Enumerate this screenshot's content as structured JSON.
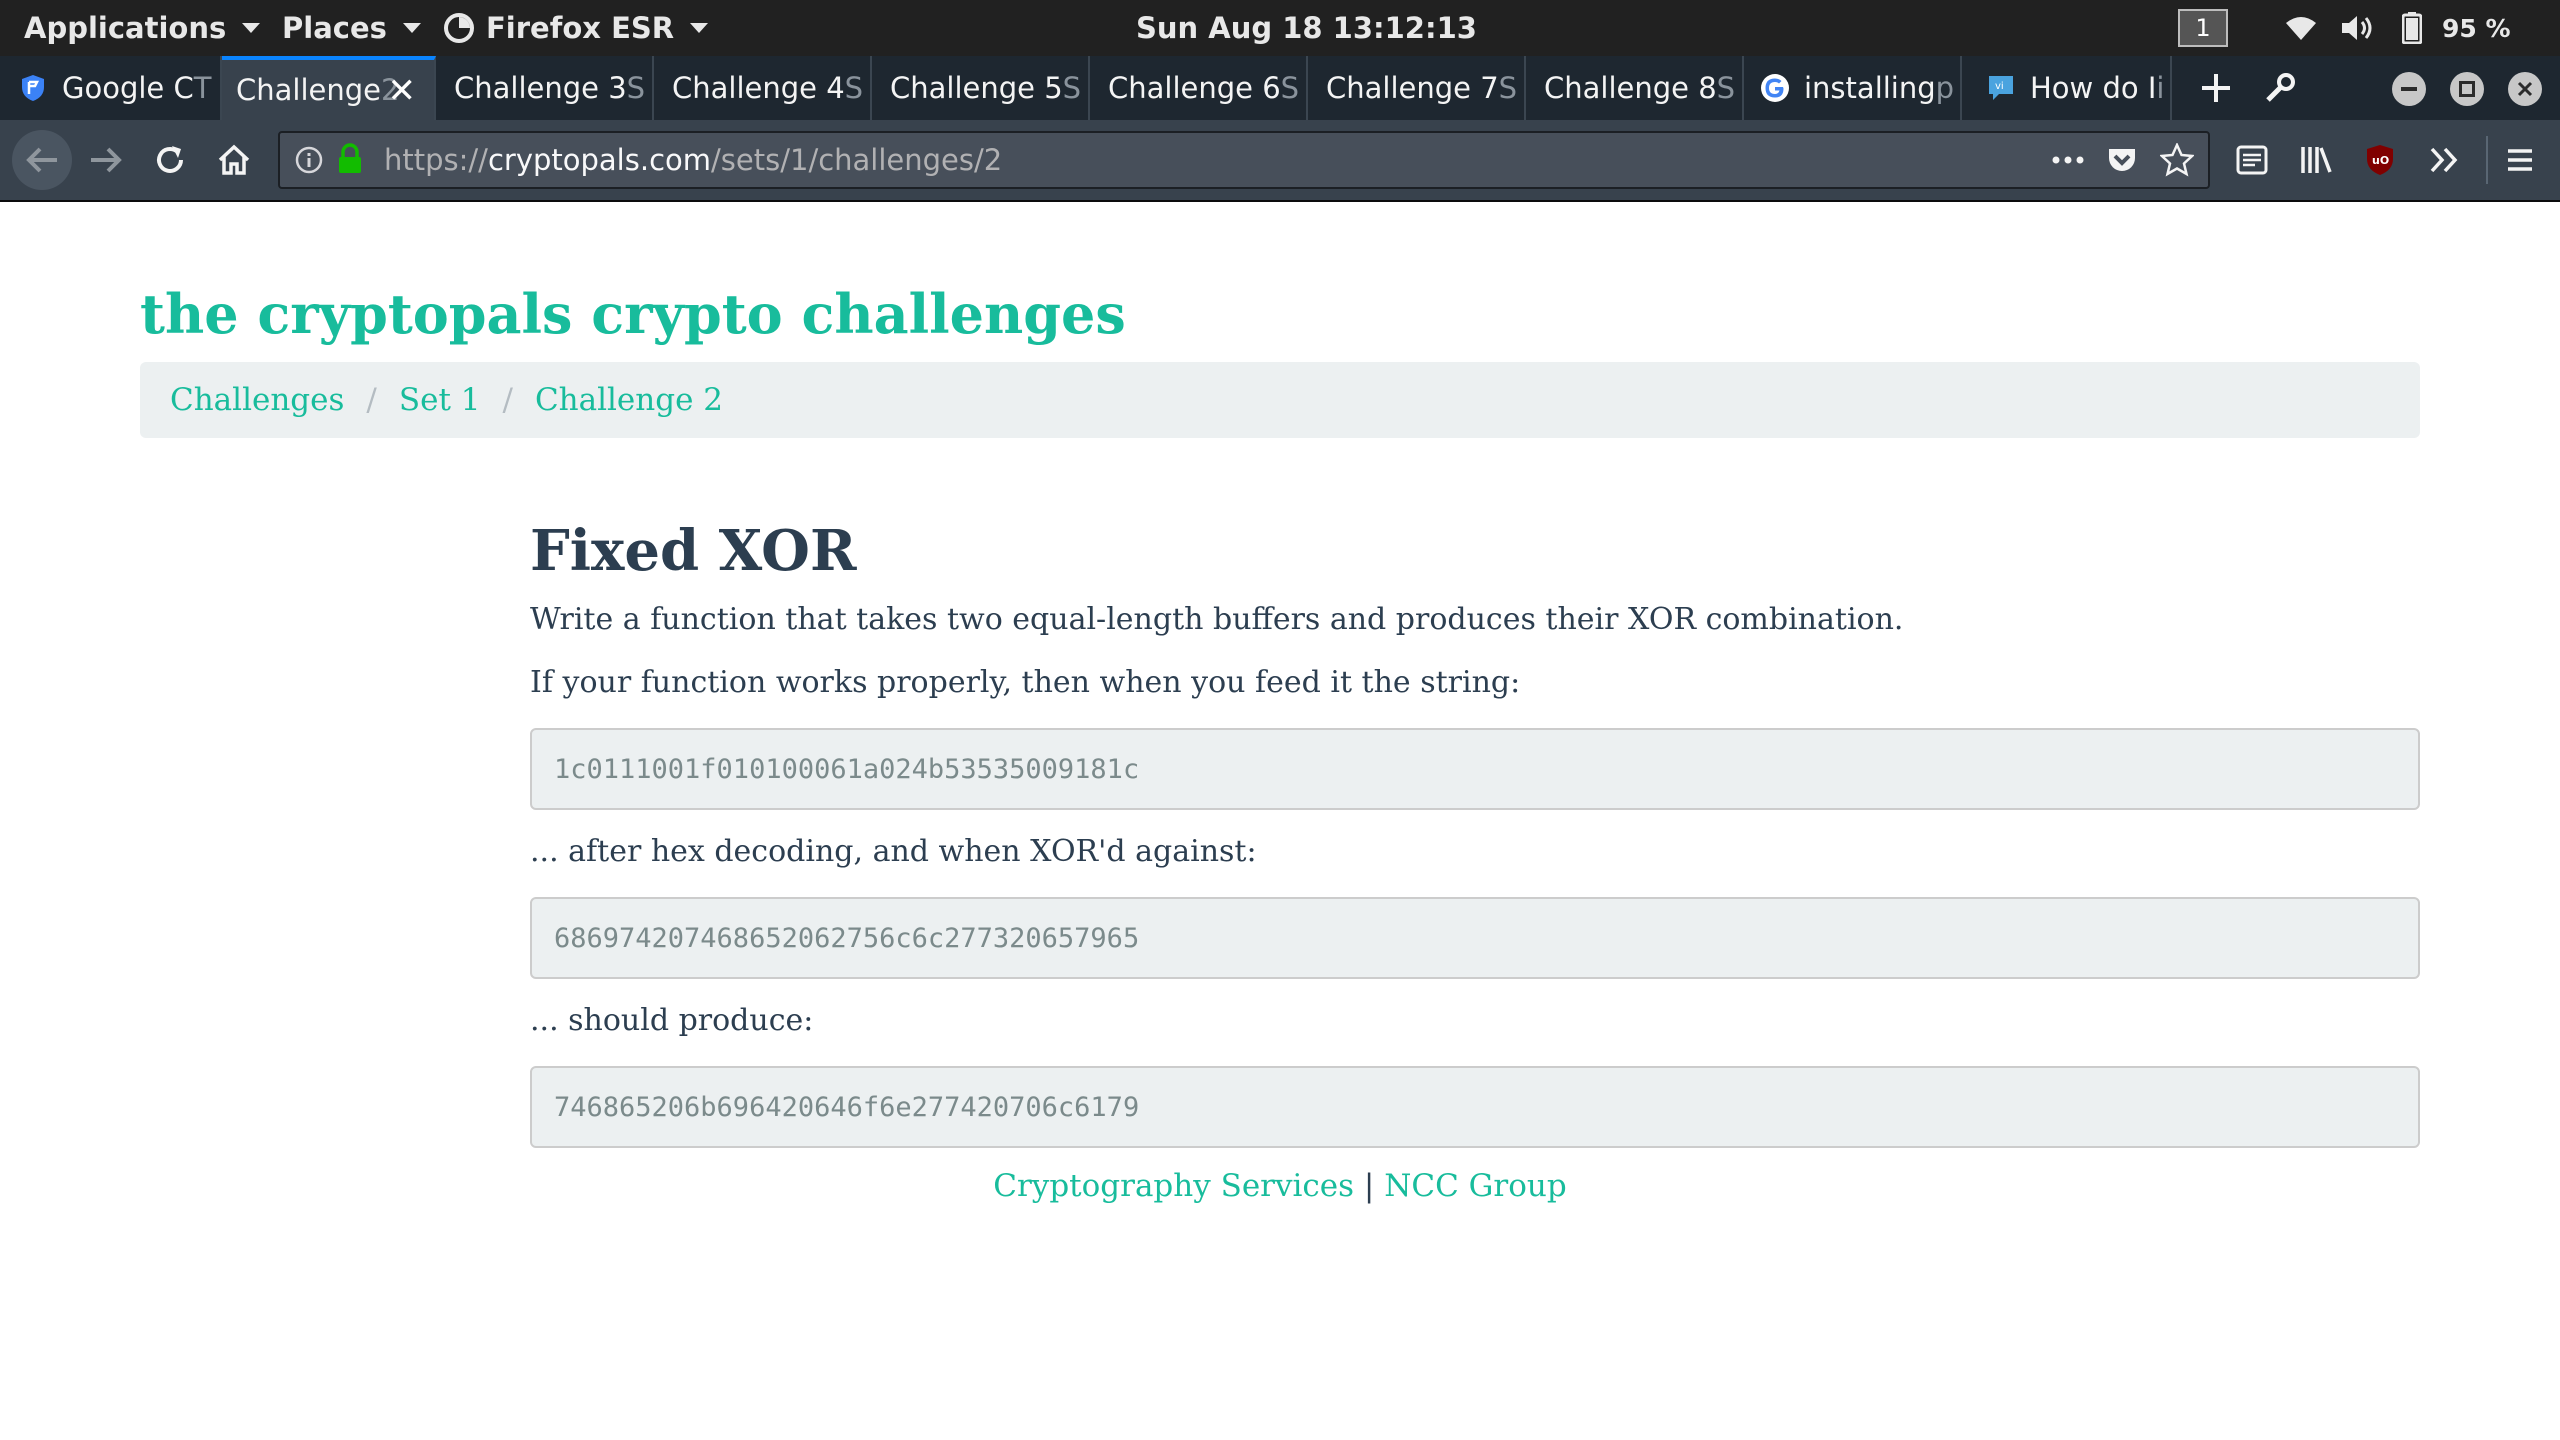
{
  "topbar": {
    "applications": "Applications",
    "places": "Places",
    "firefox": "Firefox ESR",
    "clock": "Sun Aug 18  13:12:13",
    "workspace": "1",
    "battery": "95 %"
  },
  "tabs": [
    {
      "label": "Google CT",
      "main": "Google C",
      "fade": "T",
      "favicon": "shield-icon",
      "active": false
    },
    {
      "label": "Challenge 2",
      "main": "Challenge",
      "fade": " 2",
      "favicon": "",
      "active": true
    },
    {
      "label": "Challenge 3 S",
      "main": "Challenge 3",
      "fade": " S",
      "favicon": "",
      "active": false
    },
    {
      "label": "Challenge 4 S",
      "main": "Challenge 4",
      "fade": " S",
      "favicon": "",
      "active": false
    },
    {
      "label": "Challenge 5 S",
      "main": "Challenge 5",
      "fade": " S",
      "favicon": "",
      "active": false
    },
    {
      "label": "Challenge 6 S",
      "main": "Challenge 6",
      "fade": " S",
      "favicon": "",
      "active": false
    },
    {
      "label": "Challenge 7 S",
      "main": "Challenge 7",
      "fade": " S",
      "favicon": "",
      "active": false
    },
    {
      "label": "Challenge 8 S",
      "main": "Challenge 8",
      "fade": " S",
      "favicon": "",
      "active": false
    },
    {
      "label": "installing p",
      "main": "installing",
      "fade": " p",
      "favicon": "google-icon",
      "active": false
    },
    {
      "label": "How do I i",
      "main": "How do I",
      "fade": " i",
      "favicon": "vi-icon",
      "active": false
    }
  ],
  "navbar": {
    "url_scheme": "https://",
    "url_host": "cryptopals.com",
    "url_path": "/sets/1/challenges/2",
    "ublock_badge": "uO"
  },
  "page": {
    "site_title": "the cryptopals crypto challenges",
    "breadcrumb": [
      "Challenges",
      "Set 1",
      "Challenge 2"
    ],
    "breadcrumb_sep": "/",
    "heading": "Fixed XOR",
    "intro": "Write a function that takes two equal-length buffers and produces their XOR combination.",
    "feed_text": "If your function works properly, then when you feed it the string:",
    "input_hex": "1c0111001f010100061a024b53535009181c",
    "after_text": "... after hex decoding, and when XOR'd against:",
    "key_hex": "686974207468652062756c6c277320657965",
    "produce_text": "... should produce:",
    "output_hex": "746865206b696420646f6e277420706c6179",
    "footer_link_1": "Cryptography Services",
    "footer_sep": "|",
    "footer_link_2": "NCC Group"
  },
  "colors": {
    "accent": "#18bc9c",
    "text": "#2c3e50",
    "well": "#ecf0f1",
    "tab_active": "#38424d",
    "tab_strip": "#1e2730"
  }
}
